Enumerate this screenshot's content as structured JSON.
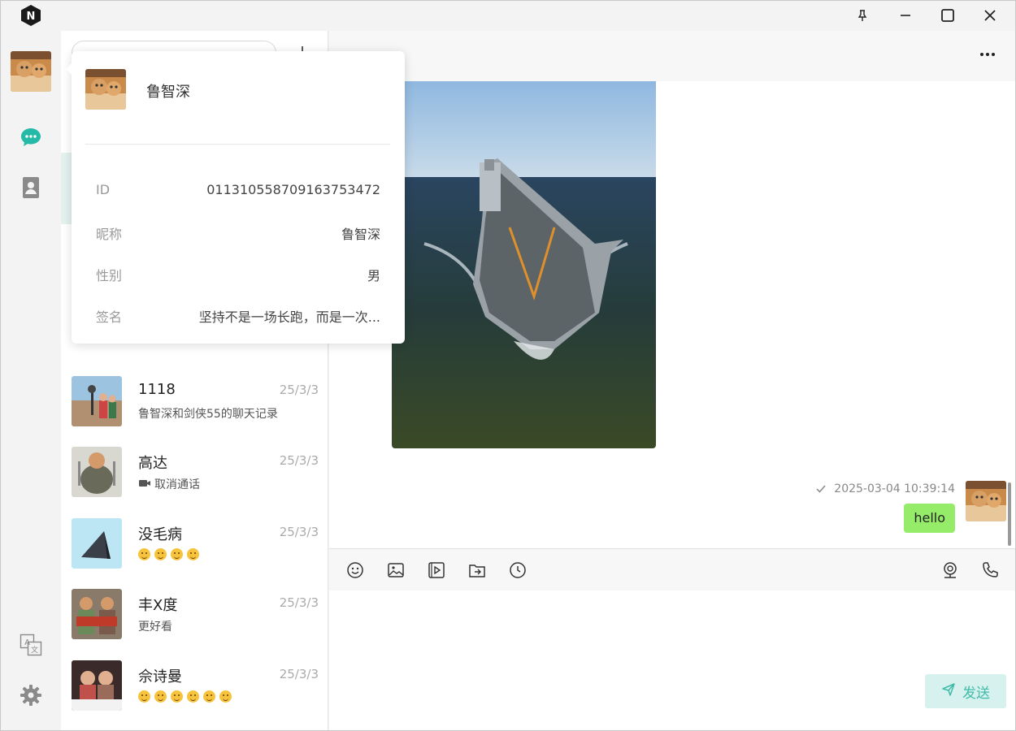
{
  "app": {
    "logo_letter": "N",
    "accent": "#25b9a8"
  },
  "window_controls": {
    "pin": "pin-icon",
    "minimize": "minimize-icon",
    "maximize": "maximize-icon",
    "close": "close-icon"
  },
  "rail": {
    "items": [
      "chat-icon",
      "contacts-icon",
      "translate-icon",
      "settings-icon"
    ]
  },
  "sessions": [
    {
      "name": "1118",
      "date": "25/3/3",
      "preview": "鲁智深和剑侠55的聊天记录"
    },
    {
      "name": "高达",
      "date": "25/3/3",
      "preview": "取消通话"
    },
    {
      "name": "没毛病",
      "date": "25/3/3",
      "preview": ""
    },
    {
      "name": "丰X度",
      "date": "25/3/3",
      "preview": "更好看"
    },
    {
      "name": "佘诗曼",
      "date": "25/3/3",
      "preview": ""
    }
  ],
  "profile_popover": {
    "name": "鲁智深",
    "fields": [
      {
        "key": "ID",
        "value": "011310558709163753472"
      },
      {
        "key": "昵称",
        "value": "鲁智深"
      },
      {
        "key": "性别",
        "value": "男"
      },
      {
        "key": "签名",
        "value": "坚持不是一场长跑，而是一次..."
      }
    ]
  },
  "chat": {
    "message": {
      "timestamp": "2025-03-04 10:39:14",
      "text": "hello"
    },
    "send_label": "发送"
  }
}
